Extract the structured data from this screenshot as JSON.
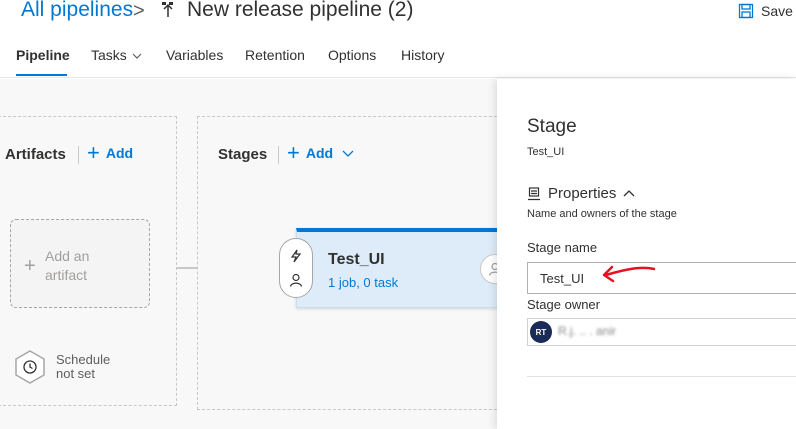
{
  "header": {
    "breadcrumb_root": "All pipelines",
    "breadcrumb_separator": ">",
    "pipeline_icon": "pipeline-icon",
    "title": "New release pipeline (2)",
    "save_label": "Save",
    "save_icon": "save-icon"
  },
  "tabs": [
    {
      "label": "Pipeline",
      "active": true
    },
    {
      "label": "Tasks",
      "has_dropdown": true
    },
    {
      "label": "Variables"
    },
    {
      "label": "Retention"
    },
    {
      "label": "Options"
    },
    {
      "label": "History"
    }
  ],
  "artifacts": {
    "title": "Artifacts",
    "add_label": "Add",
    "placeholder": "Add an artifact",
    "schedule_text": "Schedule not set",
    "schedule_icon": "clock-icon"
  },
  "stages": {
    "title": "Stages",
    "add_label": "Add",
    "card": {
      "name": "Test_UI",
      "summary": "1 job, 0 task"
    }
  },
  "details_panel": {
    "title": "Stage",
    "subtitle": "Test_UI",
    "section_title": "Properties",
    "section_icon": "properties-icon",
    "section_description": "Name and owners of the stage",
    "stage_name_label": "Stage name",
    "stage_name_value": "Test_UI",
    "stage_owner_label": "Stage owner",
    "owner_initials": "RT",
    "owner_name": "R.j. .. . anir"
  },
  "colors": {
    "accent": "#0078d4",
    "stage_card_bg": "#deecf9",
    "annotation_arrow": "#e81123",
    "avatar_bg": "#1a2b57"
  }
}
